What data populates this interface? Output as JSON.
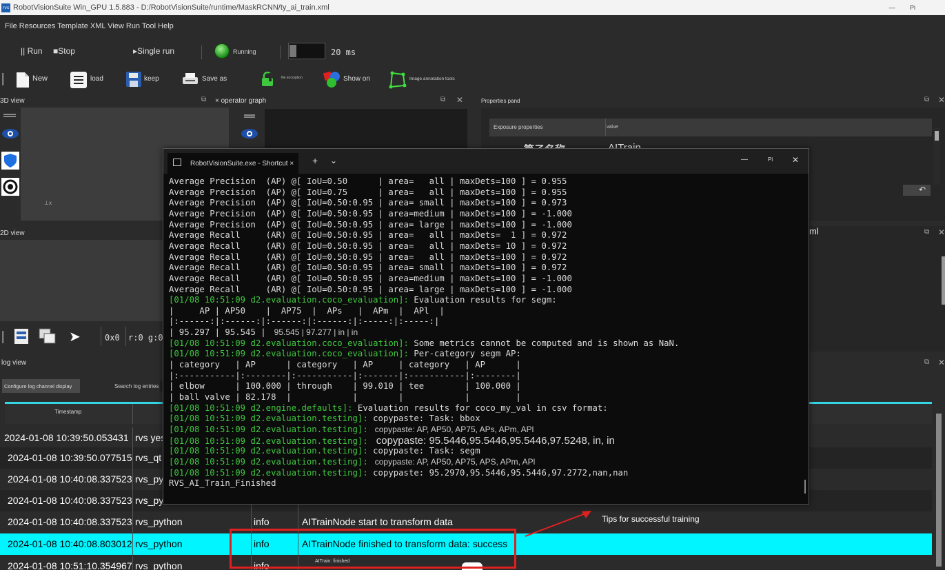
{
  "window": {
    "app_icon": "rvs",
    "title": "RobotVisionSuite Win_GPU 1.5.883 - D:/RobotVisionSuite/runtime/MaskRCNN/ty_ai_train.xml",
    "min_glyph": "—",
    "max_glyph": "Pi"
  },
  "menu": {
    "items": "File Resources Template XML View Run Tool Help"
  },
  "runbar": {
    "run_label": "|| Run",
    "stop_label": "■Stop",
    "single_run_label": "▸Single run",
    "running_label": "Running",
    "interval_label": "20 ms"
  },
  "toolbar": {
    "new_label": "New",
    "load_label": "load",
    "keep_label": "keep",
    "save_as_label": "Save as",
    "file_encryption_label": "file encryption",
    "show_on_label": "Show on",
    "image_annotation_label": "Image annotation tools"
  },
  "panels": {
    "view3d_title": "3D view",
    "operator_graph_title": "× operator graph",
    "properties_title": "Properties pand",
    "exposure_col": "Exposure properties",
    "value_col": "value",
    "prop_name_partial": "算子名称",
    "prop_value_partial": "AITrain",
    "view2d_title": "2D view",
    "xml_partial": "ml",
    "coord_readout": "0x0",
    "rgb_readout": "r:0 g:0"
  },
  "log": {
    "title": "log view",
    "configure_btn": "Configure log channel display",
    "search_label": "Search log entries",
    "timestamp_col": "Timestamp",
    "rows": [
      {
        "ts": "2024-01-08 10:39:50.053431",
        "ch": "rvs yes",
        "lvl": "",
        "msg": ""
      },
      {
        "ts": "2024-01-08 10:39:50.077515",
        "ch": "rvs_qt",
        "lvl": "",
        "msg": ""
      },
      {
        "ts": "2024-01-08 10:40:08.337523",
        "ch": "rvs_pyt",
        "lvl": "",
        "msg": ""
      },
      {
        "ts": "2024-01-08 10:40:08.337523",
        "ch": "rvs_pyt",
        "lvl": "",
        "msg": ""
      },
      {
        "ts": "2024-01-08 10:40:08.337523",
        "ch": "rvs_python",
        "lvl": "info",
        "msg": "AITrainNode start to transform data"
      },
      {
        "ts": "2024-01-08 10:40:08.803012",
        "ch": "rvs_python",
        "lvl": "info",
        "msg": "AITrainNode finished to transform data: success"
      },
      {
        "ts": "2024-01-08 10:51:10.354967",
        "ch": "rvs_python",
        "lvl": "info",
        "msg": "AITrain: finished"
      }
    ]
  },
  "terminal": {
    "tab_title": "RobotVisionSuite.exe - Shortcut ×",
    "new_tab": "+",
    "dropdown": "⌄",
    "min_glyph": "—",
    "max_glyph": "Pi",
    "close_glyph": "✕",
    "lines": [
      {
        "t": "Average Precision  (AP) @[ IoU=0.50      | area=   all | maxDets=100 ] = 0.955"
      },
      {
        "t": "Average Precision  (AP) @[ IoU=0.75      | area=   all | maxDets=100 ] = 0.955"
      },
      {
        "t": "Average Precision  (AP) @[ IoU=0.50:0.95 | area= small | maxDets=100 ] = 0.973"
      },
      {
        "t": "Average Precision  (AP) @[ IoU=0.50:0.95 | area=medium | maxDets=100 ] = -1.000"
      },
      {
        "t": "Average Precision  (AP) @[ IoU=0.50:0.95 | area= large | maxDets=100 ] = -1.000"
      },
      {
        "t": "Average Recall     (AR) @[ IoU=0.50:0.95 | area=   all | maxDets=  1 ] = 0.972"
      },
      {
        "t": "Average Recall     (AR) @[ IoU=0.50:0.95 | area=   all | maxDets= 10 ] = 0.972"
      },
      {
        "t": "Average Recall     (AR) @[ IoU=0.50:0.95 | area=   all | maxDets=100 ] = 0.972"
      },
      {
        "t": "Average Recall     (AR) @[ IoU=0.50:0.95 | area= small | maxDets=100 ] = 0.972"
      },
      {
        "t": "Average Recall     (AR) @[ IoU=0.50:0.95 | area=medium | maxDets=100 ] = -1.000"
      },
      {
        "t": "Average Recall     (AR) @[ IoU=0.50:0.95 | area= large | maxDets=100 ] = -1.000"
      },
      {
        "g": "[01/08 10:51:09 d2.evaluation.coco_evaluation]:",
        "t": " Evaluation results for segm:"
      },
      {
        "t": "|     AP | AP50    |  AP75  |  APs   |  APm  |  APl  |"
      },
      {
        "t": "|:------:|:------:|:------:|:------:|:-----:|:-----:|"
      },
      {
        "t": "| 95.297 | 95.545 |",
        "s": "95.545 | 97.277 | in | in"
      },
      {
        "g": "[01/08 10:51:09 d2.evaluation.coco_evaluation]:",
        "t": " Some metrics cannot be computed and is shown as NaN."
      },
      {
        "g": "[01/08 10:51:09 d2.evaluation.coco_evaluation]:",
        "t": " Per-category segm AP:"
      },
      {
        "t": "| category   | AP      | category   | AP     | category   | AP      |"
      },
      {
        "t": "|:-----------|:--------|:-----------|:-------|:-----------|:--------|"
      },
      {
        "t": "| elbow      | 100.000 | through    | 99.010 | tee        | 100.000 |"
      },
      {
        "t": "| ball valve | 82.178  |            |        |            |         |"
      },
      {
        "g": "[01/08 10:51:09 d2.engine.defaults]:",
        "t": " Evaluation results for coco_my_val in csv format:"
      },
      {
        "g": "[01/08 10:51:09 d2.evaluation.testing]:",
        "t": " copypaste: Task: bbox"
      },
      {
        "g": "[01/08 10:51:09 d2.evaluation.testing]:",
        "s": "copypaste: AP, AP50, AP75, APs, APm, APl"
      },
      {
        "g": "[01/08 10:51:09 d2.evaluation.testing]:",
        "b": "copypaste: 95.5446,95.5446,95.5446,97.5248, in, in"
      },
      {
        "g": "[01/08 10:51:09 d2.evaluation.testing]:",
        "t": " copypaste: Task: segm"
      },
      {
        "g": "[01/08 10:51:09 d2.evaluation.testing]:",
        "s": "copypaste: AP, AP50, AP75, APS, APm, APl"
      },
      {
        "g": "[01/08 10:51:09 d2.evaluation.testing]:",
        "t": " copypaste: 95.2970,95.5446,95.5446,97.2772,nan,nan"
      },
      {
        "t": "RVS_AI_Train_Finished"
      }
    ]
  },
  "annotation": {
    "tips_text": "Tips for successful training",
    "color": "#e02020"
  }
}
